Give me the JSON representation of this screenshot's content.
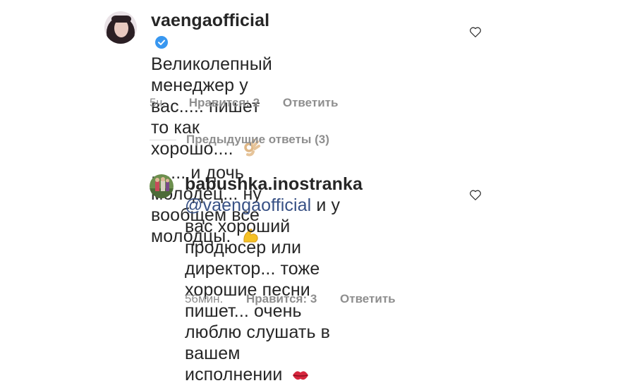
{
  "comment1": {
    "username": "vaengaofficial",
    "line1": "Великолепный",
    "line2": "менеджер у вас..... пишет то как",
    "line3a": "хорошо....",
    "line3b": "....... и дочь молодец... ну",
    "line4": "вообщем все молодцы.",
    "time": "5ч.",
    "likes": "Нравится: 2",
    "reply": "Ответить",
    "emoji1": "ok-hand-emoji",
    "emoji2": "flexed-biceps-emoji"
  },
  "view_replies": "Предыдущие ответы (3)",
  "comment2": {
    "username": "babushka.inostranka",
    "mention": "@vaengaofficial",
    "line1_rest": " и у вас хороший",
    "line2": "продюсер или директор... тоже",
    "line3": "хорошие песни пишет... очень",
    "line4": "люблю слушать в вашем",
    "line5": "исполнении",
    "time": "56мин.",
    "likes": "Нравится: 3",
    "reply": "Ответить",
    "emoji": "kiss-mark-emoji"
  },
  "colors": {
    "text": "#262626",
    "secondary": "#8e8e8e",
    "mention": "#385185",
    "verified": "#3897f0"
  }
}
